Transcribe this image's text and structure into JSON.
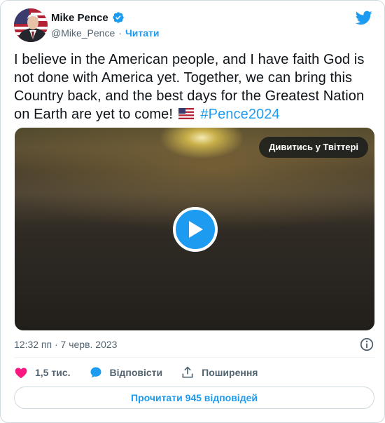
{
  "author": {
    "name": "Mike Pence",
    "handle": "@Mike_Pence",
    "separator": "·",
    "follow_label": "Читати",
    "verified": true
  },
  "tweet": {
    "text": "I believe in the American people, and I have faith God is not done with America yet. Together, we can bring this Country back, and the best days for the Greatest Nation on Earth are yet to come!",
    "hashtag": "#Pence2024",
    "emoji": "us-flag"
  },
  "media": {
    "watch_label": "Дивитись у Твіттері",
    "play_icon": "play-icon"
  },
  "timestamp": "12:32 пп · 7 черв. 2023",
  "actions": {
    "likes_count": "1,5 тис.",
    "reply_label": "Відповісти",
    "share_label": "Поширення"
  },
  "read_replies_label": "Прочитати 945 відповідей",
  "colors": {
    "accent": "#1d9bf0",
    "like": "#f91880",
    "text": "#0f1419",
    "secondary": "#536471",
    "border": "#cfd9de"
  }
}
